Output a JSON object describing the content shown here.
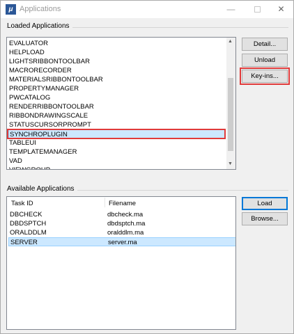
{
  "window": {
    "title": "Applications",
    "app_icon_glyph": "μ",
    "minimize_glyph": "—",
    "close_glyph": "✕"
  },
  "loaded": {
    "group_label": "Loaded Applications",
    "items": [
      "EVALUATOR",
      "HELPLOAD",
      "LIGHTSRIBBONTOOLBAR",
      "MACRORECORDER",
      "MATERIALSRIBBONTOOLBAR",
      "PROPERTYMANAGER",
      "PWCATALOG",
      "RENDERRIBBONTOOLBAR",
      "RIBBONDRAWINGSCALE",
      "STATUSCURSORPROMPT",
      "SYNCHROPLUGIN",
      "TABLEUI",
      "TEMPLATEMANAGER",
      "VAD",
      "VIEWGROUP"
    ],
    "selected_item": "SYNCHROPLUGIN",
    "highlighted_item_color": "#e03a3a"
  },
  "buttons": {
    "detail": "Detail...",
    "unload": "Unload",
    "keyins": "Key-ins...",
    "load": "Load",
    "browse": "Browse..."
  },
  "available": {
    "group_label": "Available Applications",
    "columns": [
      "Task ID",
      "Filename"
    ],
    "rows": [
      {
        "task_id": "DBCHECK",
        "filename": "dbcheck.ma"
      },
      {
        "task_id": "DBDSPTCH",
        "filename": "dbdsptch.ma"
      },
      {
        "task_id": "ORALDDLM",
        "filename": "oralddlm.ma"
      },
      {
        "task_id": "SERVER",
        "filename": "server.ma"
      }
    ],
    "selected_row": "SERVER"
  },
  "colors": {
    "selection_fill": "#cce8ff",
    "highlight_red": "#e03a3a",
    "default_button_border": "#0078d7"
  },
  "icons": {
    "scroll_up": "▲",
    "scroll_down": "▼"
  }
}
